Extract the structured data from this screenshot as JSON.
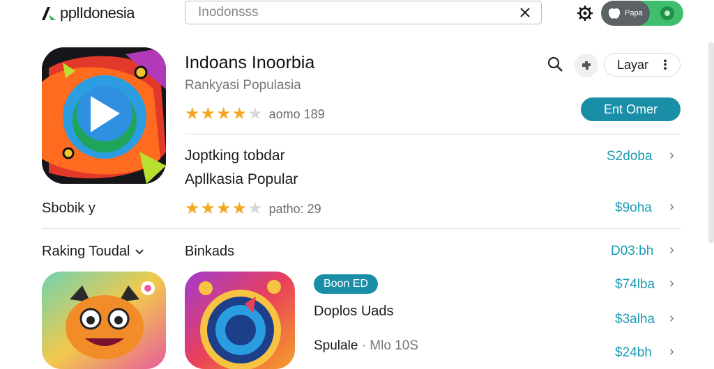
{
  "header": {
    "logo_text": "pplIdonesia",
    "search_value": "Inodonsss",
    "toggle_label": "Papa"
  },
  "app": {
    "title": "Indoans Inoorbia",
    "subtitle": "Rankyasi Populasia",
    "rating_text": "aomo 189",
    "layar_label": "Layar",
    "cta_label": "Ent Omer"
  },
  "section": {
    "line1": "Joptking tobdar",
    "line2": "Apllkasia Popular",
    "sidebar_label": "Sbobik y",
    "rating_text": "patho: 29"
  },
  "ranking": {
    "label": "Raking Toudal",
    "heading": "Binkads"
  },
  "download": {
    "badge": "Boon ED",
    "title": "Doplos Uads",
    "meta_name": "Spulale",
    "meta_extra": "Mlo 10S"
  },
  "prices": [
    "S2doba",
    "$9oha",
    "D03:bh",
    "$74lba",
    "$3alha",
    "$24bh"
  ],
  "ratings": {
    "app": 3.5,
    "section": 3.5
  },
  "colors": {
    "accent": "#1b8ea7",
    "price": "#1a9bb3",
    "star": "#f5a623",
    "toggle_on": "#3fbf6d"
  }
}
